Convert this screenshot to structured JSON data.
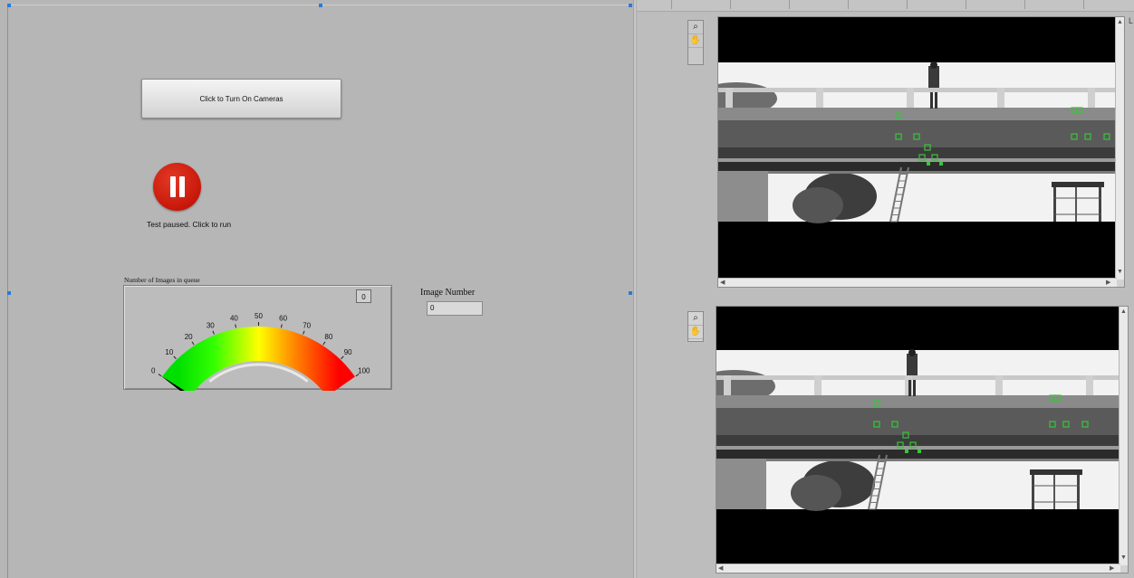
{
  "controls": {
    "camera_button_label": "Click to Turn On Cameras",
    "run_state_label": "Test paused. Click to run"
  },
  "queue_gauge": {
    "label": "Number of Images in queue",
    "min": 0,
    "max": 100,
    "value": 0,
    "readout": "0",
    "scale_labels": [
      "0",
      "10",
      "20",
      "30",
      "40",
      "50",
      "60",
      "70",
      "80",
      "90",
      "100"
    ],
    "colors": {
      "low": "#00e000",
      "mid": "#ffff00",
      "high": "#ff0000"
    }
  },
  "image_number": {
    "label": "Image Number",
    "value": "0"
  },
  "viewers": [
    {
      "name": "camera-view-1",
      "tools": [
        "zoom-icon",
        "pan-hand-icon"
      ]
    },
    {
      "name": "camera-view-2",
      "tools": [
        "zoom-icon",
        "pan-hand-icon"
      ]
    }
  ],
  "colors": {
    "panel_gray": "#b6b6b6",
    "pause_red": "#c8170a",
    "tracking_marker": "#39c43a"
  }
}
